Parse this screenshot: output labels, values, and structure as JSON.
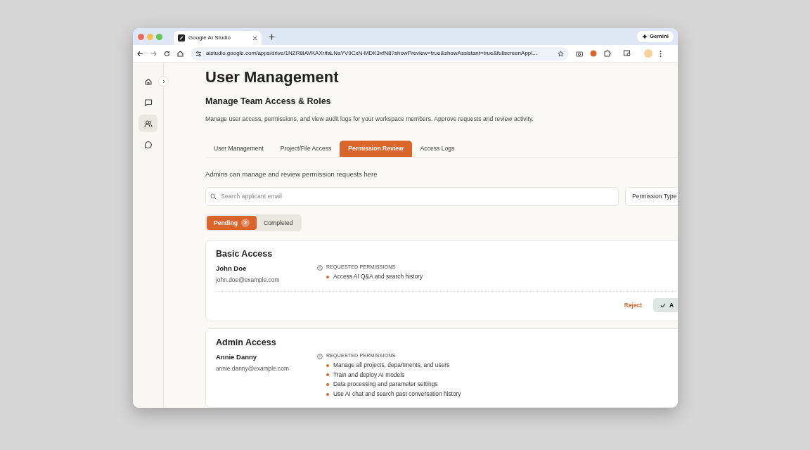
{
  "browser": {
    "tab_title": "Google AI Studio",
    "gemini_label": "Gemini",
    "url": "aistudio.google.com/apps/drive/1NZR8lAVKAXrifaLNaYV9CxN-MDK3xfN8?showPreview=true&showAssistant=true&fullscreenAppl..."
  },
  "sidebar": {
    "items": [
      {
        "kind": "home",
        "selected": false
      },
      {
        "kind": "chat",
        "selected": false
      },
      {
        "kind": "users",
        "selected": true
      },
      {
        "kind": "bubble",
        "selected": false
      }
    ]
  },
  "page": {
    "title": "User Management",
    "subtitle": "Manage Team Access & Roles",
    "description": "Manage user access, permissions, and view audit logs for your workspace members. Approve requests and review activity.",
    "tabs": [
      {
        "label": "User Management",
        "selected": false
      },
      {
        "label": "Project/File Access",
        "selected": false
      },
      {
        "label": "Permission Review",
        "selected": true
      },
      {
        "label": "Access Logs",
        "selected": false
      }
    ],
    "hint": "Admins can manage and review permission requests here",
    "search": {
      "placeholder": "Search applicant email"
    },
    "filter": {
      "label": "Permission Type"
    },
    "segments": [
      {
        "label": "Pending",
        "count": "2",
        "selected": true
      },
      {
        "label": "Completed",
        "selected": false
      }
    ],
    "requests": [
      {
        "title": "Basic Access",
        "name": "John Doe",
        "email": "john.doe@example.com",
        "section_label": "REQUESTED PERMISSIONS",
        "permissions": [
          "Access AI Q&A and search history"
        ],
        "actions": {
          "reject": "Reject",
          "approve": "A"
        }
      },
      {
        "title": "Admin Access",
        "name": "Annie Danny",
        "email": "annie.danny@example.com",
        "section_label": "REQUESTED PERMISSIONS",
        "permissions": [
          "Manage all projects, departments, and users",
          "Train and deploy AI models",
          "Data processing and parameter settings",
          "Use AI chat and search past conversation history"
        ]
      }
    ]
  }
}
